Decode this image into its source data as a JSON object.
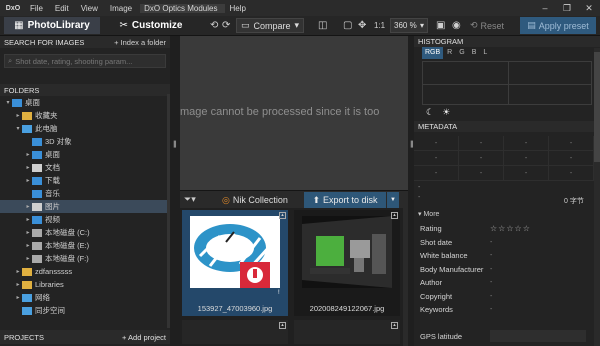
{
  "app": {
    "logo": "DxO",
    "menu": [
      "File",
      "Edit",
      "View",
      "Image",
      "DxO Optics Modules",
      "Help"
    ],
    "window_controls": [
      "–",
      "❐",
      "✕"
    ]
  },
  "toolbar": {
    "tab_library": "PhotoLibrary",
    "tab_customize": "Customize",
    "compare_label": "Compare",
    "zoom_1to1": "1:1",
    "zoom_value": "360 %",
    "reset_label": "Reset",
    "apply_preset_label": "Apply preset"
  },
  "left": {
    "search_title": "SEARCH FOR IMAGES",
    "index_folder": "+ Index a folder",
    "search_placeholder": "Shot date, rating, shooting param...",
    "folders_title": "FOLDERS",
    "tree": [
      {
        "label": "桌面",
        "arrow": "▾",
        "color": "#3a8fd8"
      },
      {
        "label": "收藏夹",
        "arrow": "▸",
        "color": "#e0b040"
      },
      {
        "label": "此电脑",
        "arrow": "▾",
        "color": "#4aa0e0"
      },
      {
        "label": "3D 对象",
        "arrow": "",
        "color": "#3a8fd8"
      },
      {
        "label": "桌面",
        "arrow": "▸",
        "color": "#3a8fd8"
      },
      {
        "label": "文档",
        "arrow": "▸",
        "color": "#cfcfcf"
      },
      {
        "label": "下载",
        "arrow": "▸",
        "color": "#3a8fd8"
      },
      {
        "label": "音乐",
        "arrow": "",
        "color": "#3a8fd8"
      },
      {
        "label": "图片",
        "arrow": "▸",
        "color": "#cfcfcf"
      },
      {
        "label": "视频",
        "arrow": "▸",
        "color": "#3a8fd8"
      },
      {
        "label": "本地磁盘 (C:)",
        "arrow": "▸",
        "color": "#aaaaaa"
      },
      {
        "label": "本地磁盘 (E:)",
        "arrow": "▸",
        "color": "#aaaaaa"
      },
      {
        "label": "本地磁盘 (F:)",
        "arrow": "▸",
        "color": "#aaaaaa"
      },
      {
        "label": "zdfansssss",
        "arrow": "▸",
        "color": "#e0b040"
      },
      {
        "label": "Libraries",
        "arrow": "▸",
        "color": "#e0b040"
      },
      {
        "label": "网络",
        "arrow": "▸",
        "color": "#4aa0e0"
      },
      {
        "label": "同步空间",
        "arrow": "",
        "color": "#4aa0e0"
      }
    ],
    "projects_title": "PROJECTS",
    "add_project": "+ Add project"
  },
  "viewer": {
    "message": "mage cannot be processed since it is too"
  },
  "filmstrip": {
    "nik_label": "Nik Collection",
    "export_label": "Export to disk",
    "thumbs": [
      {
        "name": "153927_47003960.jpg"
      },
      {
        "name": "202008249122067.jpg"
      }
    ]
  },
  "right": {
    "histogram_title": "HISTOGRAM",
    "histogram_tabs": [
      "RGB",
      "R",
      "G",
      "B",
      "L"
    ],
    "metadata_title": "METADATA",
    "grid_dash": "-",
    "bytes": "0 字节",
    "more_label": "More",
    "stars": "☆☆☆☆☆",
    "fields": [
      {
        "key": "Rating",
        "value": ""
      },
      {
        "key": "Shot date",
        "value": "-"
      },
      {
        "key": "White balance",
        "value": "-"
      },
      {
        "key": "Body Manufacturer",
        "value": "-"
      },
      {
        "key": "Author",
        "value": "-"
      },
      {
        "key": "Copyright",
        "value": "-"
      },
      {
        "key": "Keywords",
        "value": "-"
      },
      {
        "key": "",
        "value": ""
      },
      {
        "key": "GPS latitude",
        "value": ""
      }
    ]
  }
}
